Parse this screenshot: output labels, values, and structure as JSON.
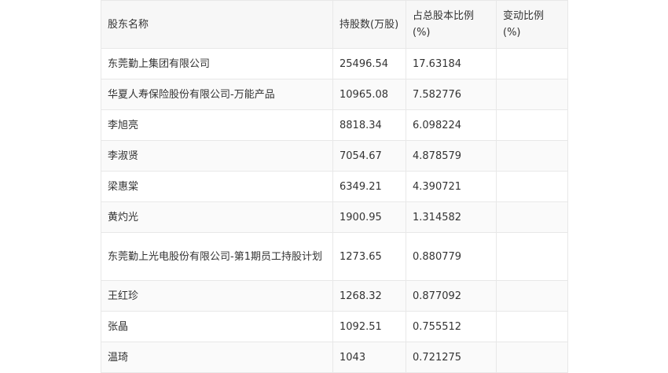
{
  "table": {
    "headers": [
      "股东名称",
      "持股数(万股)",
      "占总股本比例(%)",
      "变动比例(%)"
    ],
    "rows": [
      [
        "东莞勤上集团有限公司",
        "25496.54",
        "17.63184",
        ""
      ],
      [
        "华夏人寿保险股份有限公司-万能产品",
        "10965.08",
        "7.582776",
        ""
      ],
      [
        "李旭亮",
        "8818.34",
        "6.098224",
        ""
      ],
      [
        "李淑贤",
        "7054.67",
        "4.878579",
        ""
      ],
      [
        "梁惠棠",
        "6349.21",
        "4.390721",
        ""
      ],
      [
        "黄灼光",
        "1900.95",
        "1.314582",
        ""
      ],
      [
        "东莞勤上光电股份有限公司-第1期员工持股计划",
        "1273.65",
        "0.880779",
        ""
      ],
      [
        "王红珍",
        "1268.32",
        "0.877092",
        ""
      ],
      [
        "张晶",
        "1092.51",
        "0.755512",
        ""
      ],
      [
        "温琦",
        "1043",
        "0.721275",
        ""
      ]
    ]
  }
}
